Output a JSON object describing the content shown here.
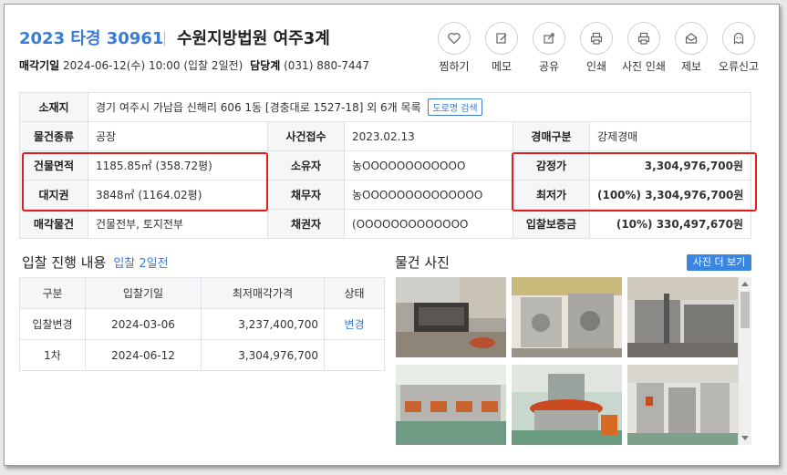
{
  "header": {
    "case_no": "2023 타경 30961",
    "court": "수원지방법원 여주3계",
    "sale_date_label": "매각기일",
    "sale_date_value": "2024-06-12(수) 10:00 (입찰 2일전)",
    "contact_label": "담당계",
    "contact_value": "(031) 880-7447"
  },
  "actions": [
    {
      "label": "찜하기",
      "icon": "heart-icon"
    },
    {
      "label": "메모",
      "icon": "edit-icon"
    },
    {
      "label": "공유",
      "icon": "share-icon"
    },
    {
      "label": "인쇄",
      "icon": "print-icon"
    },
    {
      "label": "사진 인쇄",
      "icon": "print-icon"
    },
    {
      "label": "제보",
      "icon": "envelope-icon"
    },
    {
      "label": "오류신고",
      "icon": "ghost-icon"
    }
  ],
  "info": {
    "location_label": "소재지",
    "location_value": "경기 여주시 가남읍 신해리 606 1동 [경충대로 1527-18] 외 6개 목록",
    "road_search": "도로명 검색",
    "type_label": "물건종류",
    "type_value": "공장",
    "received_label": "사건접수",
    "received_value": "2023.02.13",
    "auction_type_label": "경매구분",
    "auction_type_value": "강제경매",
    "building_area_label": "건물면적",
    "building_area_value": "1185.85㎡ (358.72평)",
    "owner_label": "소유자",
    "owner_value": "농OOOOOOOOOOOO",
    "appraisal_label": "감정가",
    "appraisal_value": "3,304,976,700원",
    "land_right_label": "대지권",
    "land_right_value": "3848㎡ (1164.02평)",
    "debtor_label": "채무자",
    "debtor_value": "농OOOOOOOOOOOOOO",
    "min_price_label": "최저가",
    "min_price_value": "(100%) 3,304,976,700원",
    "sale_items_label": "매각물건",
    "sale_items_value": "건물전부, 토지전부",
    "creditor_label": "채권자",
    "creditor_value": "(OOOOOOOOOOOOO",
    "deposit_label": "입찰보증금",
    "deposit_value": "(10%) 330,497,670원"
  },
  "progress": {
    "title": "입찰 진행 내용",
    "subtitle": "입찰 2일전",
    "headers": [
      "구분",
      "입찰기일",
      "최저매각가격",
      "상태"
    ],
    "rows": [
      {
        "type": "입찰변경",
        "date": "2024-03-06",
        "price": "3,237,400,700",
        "status": "변경"
      },
      {
        "type": "1차",
        "date": "2024-06-12",
        "price": "3,304,976,700",
        "status": ""
      }
    ]
  },
  "photos": {
    "title": "물건 사진",
    "more_button": "사진 더 보기"
  },
  "colors": {
    "accent": "#3a7bd5",
    "highlight_box": "#e02020"
  }
}
